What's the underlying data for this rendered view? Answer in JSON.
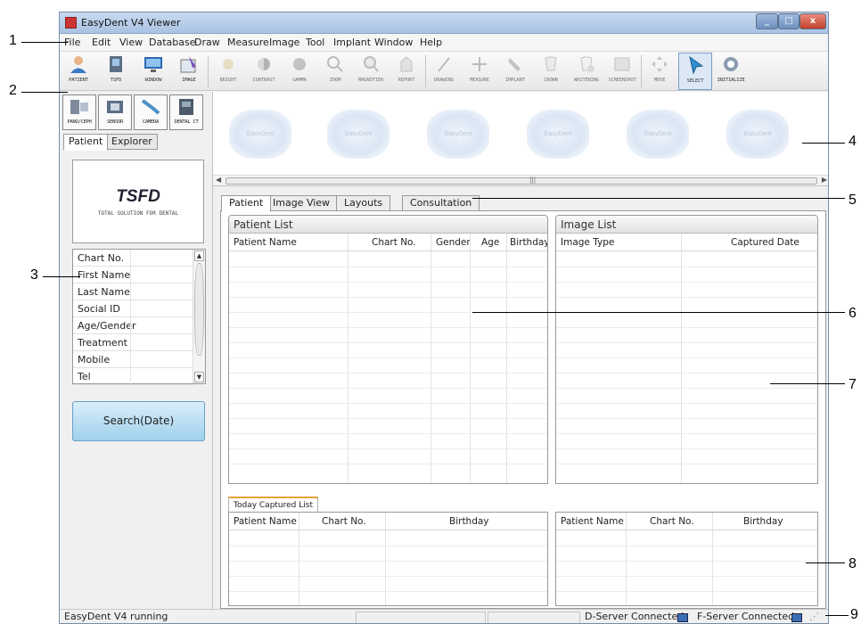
{
  "window": {
    "title": "EasyDent V4 Viewer",
    "min": "_",
    "max": "□",
    "close": "x"
  },
  "menu": [
    "File",
    "Edit",
    "View",
    "Database",
    "Draw",
    "Measure",
    "Image",
    "Tool",
    "Implant",
    "Window",
    "Help"
  ],
  "toolbar": {
    "tools": [
      {
        "label": "PATIENT",
        "icon": "patient-icon"
      },
      {
        "label": "TSFD",
        "icon": "tsfd-icon"
      },
      {
        "label": "WINDOW",
        "icon": "window-icon"
      },
      {
        "label": "IMAGE",
        "icon": "image-icon"
      },
      {
        "label": "BRIGHT",
        "icon": "brightness-icon"
      },
      {
        "label": "CONTRAST",
        "icon": "contrast-icon"
      },
      {
        "label": "GAMMA",
        "icon": "gamma-icon"
      },
      {
        "label": "ZOOM",
        "icon": "zoom-icon"
      },
      {
        "label": "MAGNIFIER",
        "icon": "magnifier-icon"
      },
      {
        "label": "REPORT",
        "icon": "report-icon"
      },
      {
        "label": "DRAWING",
        "icon": "drawing-icon"
      },
      {
        "label": "MEASURE",
        "icon": "measure-icon"
      },
      {
        "label": "IMPLANT",
        "icon": "implant-icon"
      },
      {
        "label": "CROWN",
        "icon": "crown-icon"
      },
      {
        "label": "WHITENING",
        "icon": "whitening-icon"
      },
      {
        "label": "SCREENSHOT",
        "icon": "screenshot-icon"
      },
      {
        "label": "MOVE",
        "icon": "move-icon"
      },
      {
        "label": "SELECT",
        "icon": "select-icon"
      },
      {
        "label": "INITIALIZE",
        "icon": "initialize-icon"
      }
    ]
  },
  "left": {
    "devices": [
      "PANO/CEPH",
      "SENSOR",
      "CAMERA",
      "DENTAL CT"
    ],
    "tabs": [
      "Patient",
      "Explorer"
    ],
    "logo": {
      "name": "TSFD",
      "tagline": "TOTAL SOLUTION FOR DENTAL"
    },
    "fields": [
      "Chart No.",
      "First Name",
      "Last Name",
      "Social ID",
      "Age/Gender",
      "Treatment",
      "Mobile",
      "Tel"
    ],
    "search_label": "Search(Date)"
  },
  "thumbnails": [
    "EasyDent",
    "EasyDent",
    "EasyDent",
    "EasyDent",
    "EasyDent",
    "EasyDent"
  ],
  "main": {
    "tabs": [
      "Patient",
      "Image View",
      "Layouts",
      "Consultation"
    ],
    "patient_list": {
      "title": "Patient List",
      "columns": [
        "Patient Name",
        "Chart No.",
        "Gender",
        "Age",
        "Birthday"
      ]
    },
    "image_list": {
      "title": "Image List",
      "columns": [
        "Image Type",
        "Captured Date"
      ]
    },
    "today_tab": "Today Captured List",
    "today_list": {
      "columns": [
        "Patient Name",
        "Chart No.",
        "Birthday"
      ]
    },
    "right_list": {
      "columns": [
        "Patient Name",
        "Chart No.",
        "Birthday"
      ]
    }
  },
  "status": {
    "left": "EasyDent V4 running",
    "dserver": "D-Server Connected",
    "fserver": "F-Server Connected"
  },
  "annotations": [
    "1",
    "2",
    "3",
    "4",
    "5",
    "6",
    "7",
    "8",
    "9"
  ]
}
